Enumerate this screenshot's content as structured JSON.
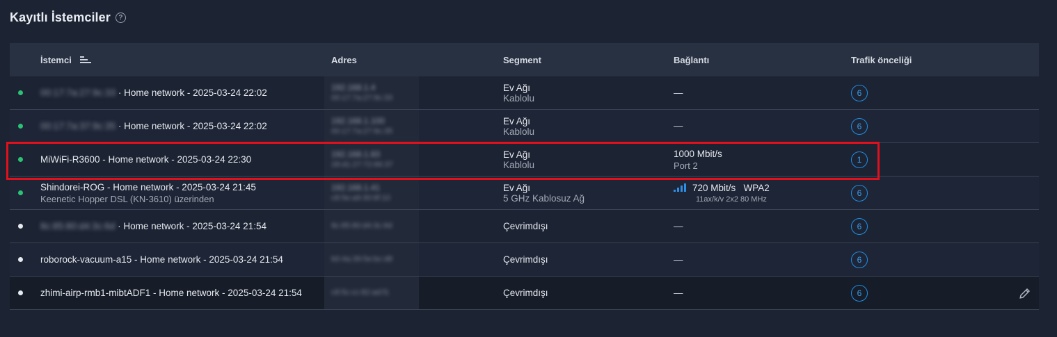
{
  "header": {
    "title": "Kayıtlı İstemciler",
    "help_icon": "question-circle-icon"
  },
  "columns": [
    "İstemci",
    "Adres",
    "Segment",
    "Bağlantı",
    "Trafik önceliği"
  ],
  "rows": [
    {
      "status": "online",
      "client_blurred": "00:17:7a:27:9c:33",
      "client_text": " · Home network - 2025-03-24 22:02",
      "client_sub": "",
      "addr_ip": "192.168.1.4",
      "addr_mac": "00:17:7a:27:9c:33",
      "segment": "Ev Ağı",
      "segment_sub": "Kablolu",
      "conn": "—",
      "conn_sub": "",
      "priority": "6"
    },
    {
      "status": "online",
      "client_blurred": "00:17:7a:37:9c:35",
      "client_text": " · Home network - 2025-03-24 22:02",
      "client_sub": "",
      "addr_ip": "192.168.1.100",
      "addr_mac": "00:17:7a:27:9c:35",
      "segment": "Ev Ağı",
      "segment_sub": "Kablolu",
      "conn": "—",
      "conn_sub": "",
      "priority": "6"
    },
    {
      "status": "online",
      "client_blurred": "",
      "client_text": "MiWiFi-R3600 - Home network - 2025-03-24 22:30",
      "client_sub": "",
      "addr_ip": "192.168.1.83",
      "addr_mac": "28:d1:27:72:66:37",
      "segment": "Ev Ağı",
      "segment_sub": "Kablolu",
      "conn": "1000 Mbit/s",
      "conn_sub": "Port 2",
      "priority": "1"
    },
    {
      "status": "online",
      "client_blurred": "",
      "client_text": "Shindorei-ROG - Home network - 2025-03-24 21:45",
      "client_sub": "Keenetic Hopper DSL (KN-3610) üzerinden",
      "addr_ip": "192.168.1.41",
      "addr_mac": "c8:5e:a9:30:6f:10",
      "segment": "Ev Ağı",
      "segment_sub": "5 GHz Kablosuz Ağ",
      "conn": "720 Mbit/s   WPA2",
      "conn_sub": "11ax/k/v 2x2 80 MHz",
      "priority": "6"
    },
    {
      "status": "offline",
      "client_blurred": "8c:85:80:d4:3c:6d",
      "client_text": " · Home network - 2025-03-24 21:54",
      "client_sub": "",
      "addr_ip": "",
      "addr_mac": "8c:85:80:d4:3c:6d",
      "segment": "Çevrimdışı",
      "segment_sub": "",
      "conn": "—",
      "conn_sub": "",
      "priority": "6"
    },
    {
      "status": "offline",
      "client_blurred": "",
      "client_text": "roborock-vacuum-a15 - Home network - 2025-03-24 21:54",
      "client_sub": "",
      "addr_ip": "",
      "addr_mac": "b0:4a:39:5e:bc:d8",
      "segment": "Çevrimdışı",
      "segment_sub": "",
      "conn": "—",
      "conn_sub": "",
      "priority": "6"
    },
    {
      "status": "offline",
      "client_blurred": "",
      "client_text": "zhimi-airp-rmb1-mibtADF1 - Home network - 2025-03-24 21:54",
      "client_sub": "",
      "addr_ip": "",
      "addr_mac": "c8:5c:cc:82:ad:f1",
      "segment": "Çevrimdışı",
      "segment_sub": "",
      "conn": "—",
      "conn_sub": "",
      "priority": "6"
    }
  ],
  "colors": {
    "background": "#1c2333",
    "accent": "#1f8fe6",
    "online": "#2bc275",
    "highlight": "#e0101c"
  }
}
